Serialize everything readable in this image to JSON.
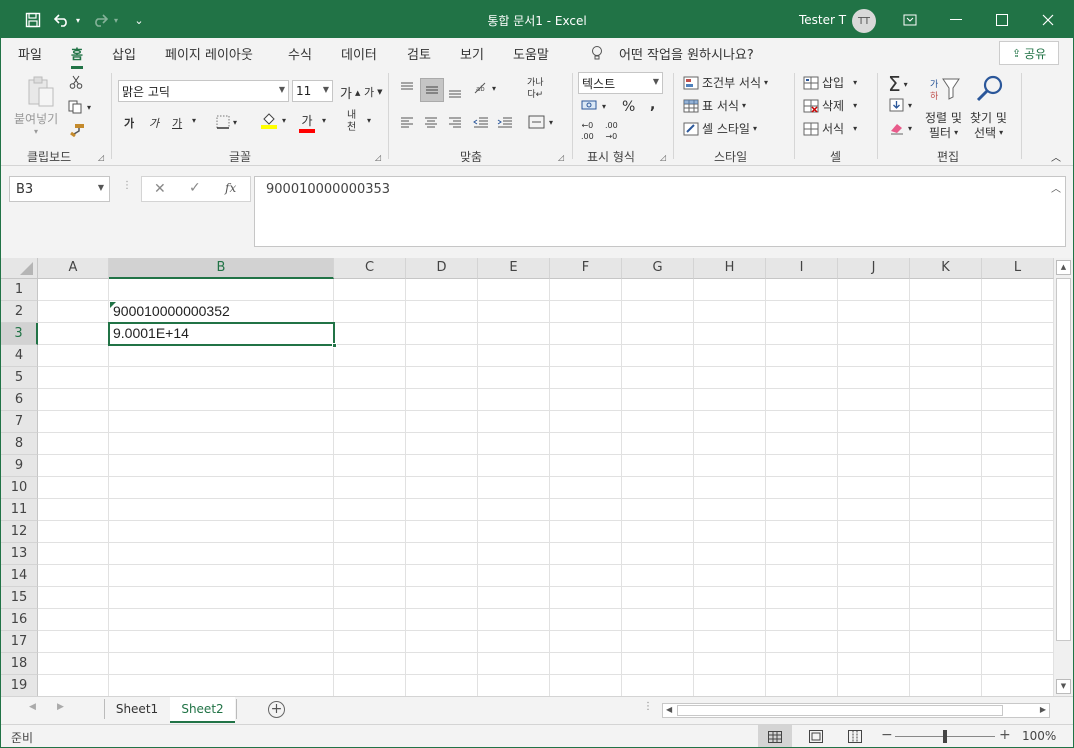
{
  "titlebar": {
    "title": "통합 문서1  -  Excel",
    "user": "Tester T",
    "avatar_initials": "TT",
    "qat_more": "⌄"
  },
  "menu": {
    "items": [
      "파일",
      "홈",
      "삽입",
      "페이지 레이아웃",
      "수식",
      "데이터",
      "검토",
      "보기",
      "도움말"
    ],
    "active": "홈",
    "tell_me": "어떤 작업을 원하시나요?",
    "share": "공유"
  },
  "ribbon": {
    "clipboard": {
      "label": "클립보드",
      "paste": "붙여넣기"
    },
    "font": {
      "label": "글꼴",
      "font_name": "맑은 고딕",
      "font_size": "11",
      "bold": "가",
      "italic": "가",
      "underline": "가",
      "grow": "가",
      "shrink": "가",
      "color_a": "가"
    },
    "alignment": {
      "label": "맞춤"
    },
    "number": {
      "label": "표시 형식",
      "format": "텍스트"
    },
    "styles": {
      "label": "스타일",
      "conditional": "조건부 서식",
      "table": "표 서식",
      "cell_styles": "셀 스타일"
    },
    "cells": {
      "label": "셀",
      "insert": "삽입",
      "delete": "삭제",
      "format": "서식"
    },
    "editing": {
      "label": "편집",
      "sort": "정렬 및",
      "filter": "필터",
      "find": "찾기 및",
      "select": "선택"
    }
  },
  "formula_bar": {
    "name_box": "B3",
    "content": "900010000000353"
  },
  "grid": {
    "columns": [
      "A",
      "B",
      "C",
      "D",
      "E",
      "F",
      "G",
      "H",
      "I",
      "J",
      "K",
      "L"
    ],
    "rows": [
      "1",
      "2",
      "3",
      "4",
      "5",
      "6",
      "7",
      "8",
      "9",
      "10",
      "11",
      "12",
      "13",
      "14",
      "15",
      "16",
      "17",
      "18",
      "19"
    ],
    "selected_column": "B",
    "selected_row": "3",
    "cells": {
      "B2": "900010000000352",
      "B3": "9.0001E+14"
    }
  },
  "sheets": {
    "tabs": [
      "Sheet1",
      "Sheet2"
    ],
    "active": "Sheet2"
  },
  "status": {
    "mode": "준비",
    "zoom": "100%"
  },
  "colors": {
    "accent": "#217346"
  }
}
